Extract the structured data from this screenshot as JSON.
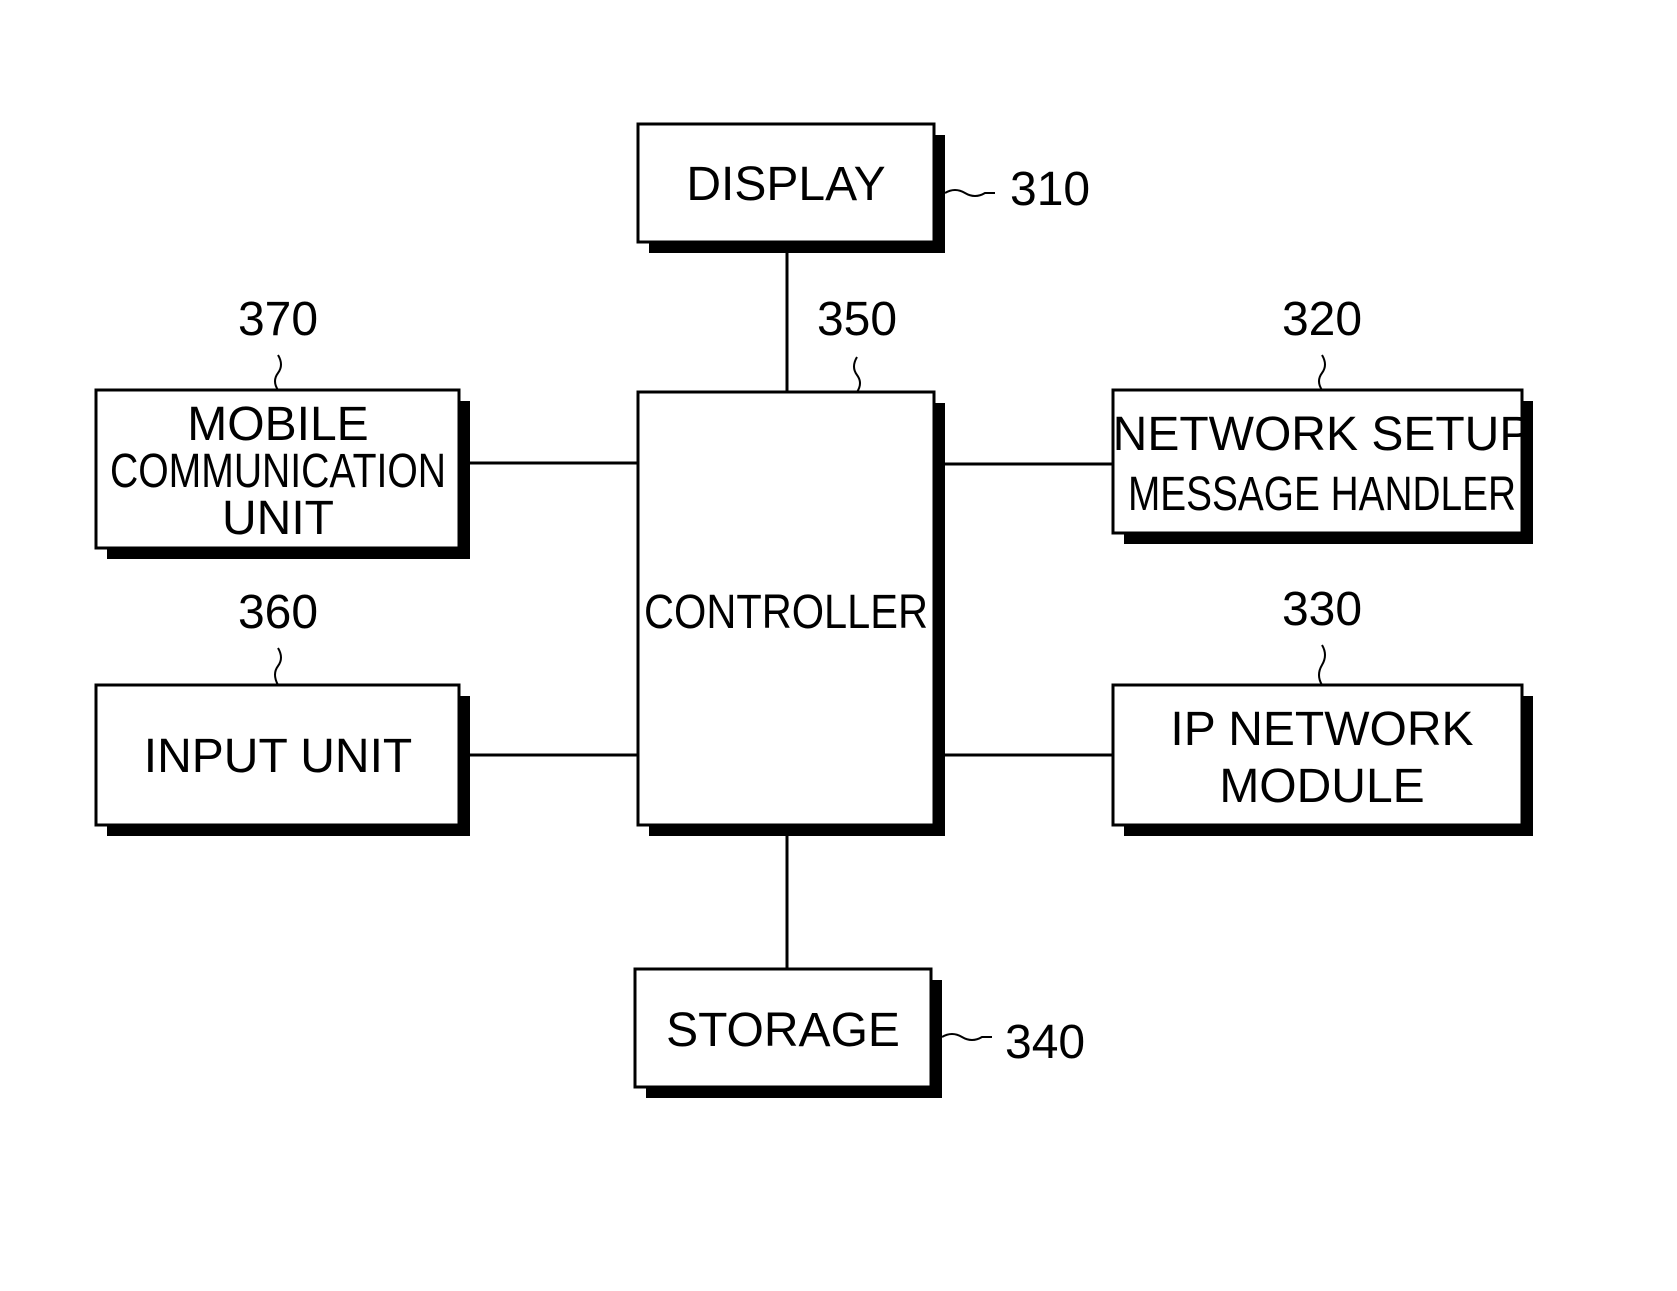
{
  "diagram": {
    "type": "block-diagram",
    "colors": {
      "stroke": "#000000",
      "fill": "#ffffff",
      "shadow": "#000000"
    },
    "blocks": [
      {
        "id": "display",
        "ref": "310",
        "lines": [
          "DISPLAY"
        ]
      },
      {
        "id": "controller",
        "ref": "350",
        "lines": [
          "CONTROLLER"
        ]
      },
      {
        "id": "storage",
        "ref": "340",
        "lines": [
          "STORAGE"
        ]
      },
      {
        "id": "mobile-communication-unit",
        "ref": "370",
        "lines": [
          "MOBILE",
          "COMMUNICATION",
          "UNIT"
        ]
      },
      {
        "id": "input-unit",
        "ref": "360",
        "lines": [
          "INPUT UNIT"
        ]
      },
      {
        "id": "network-setup-message-handler",
        "ref": "320",
        "lines": [
          "NETWORK SETUP",
          "MESSAGE HANDLER"
        ]
      },
      {
        "id": "ip-network-module",
        "ref": "330",
        "lines": [
          "IP NETWORK",
          "MODULE"
        ]
      }
    ],
    "connections": [
      {
        "from": "controller",
        "to": "display"
      },
      {
        "from": "controller",
        "to": "storage"
      },
      {
        "from": "controller",
        "to": "mobile-communication-unit"
      },
      {
        "from": "controller",
        "to": "input-unit"
      },
      {
        "from": "controller",
        "to": "network-setup-message-handler"
      },
      {
        "from": "controller",
        "to": "ip-network-module"
      }
    ]
  }
}
